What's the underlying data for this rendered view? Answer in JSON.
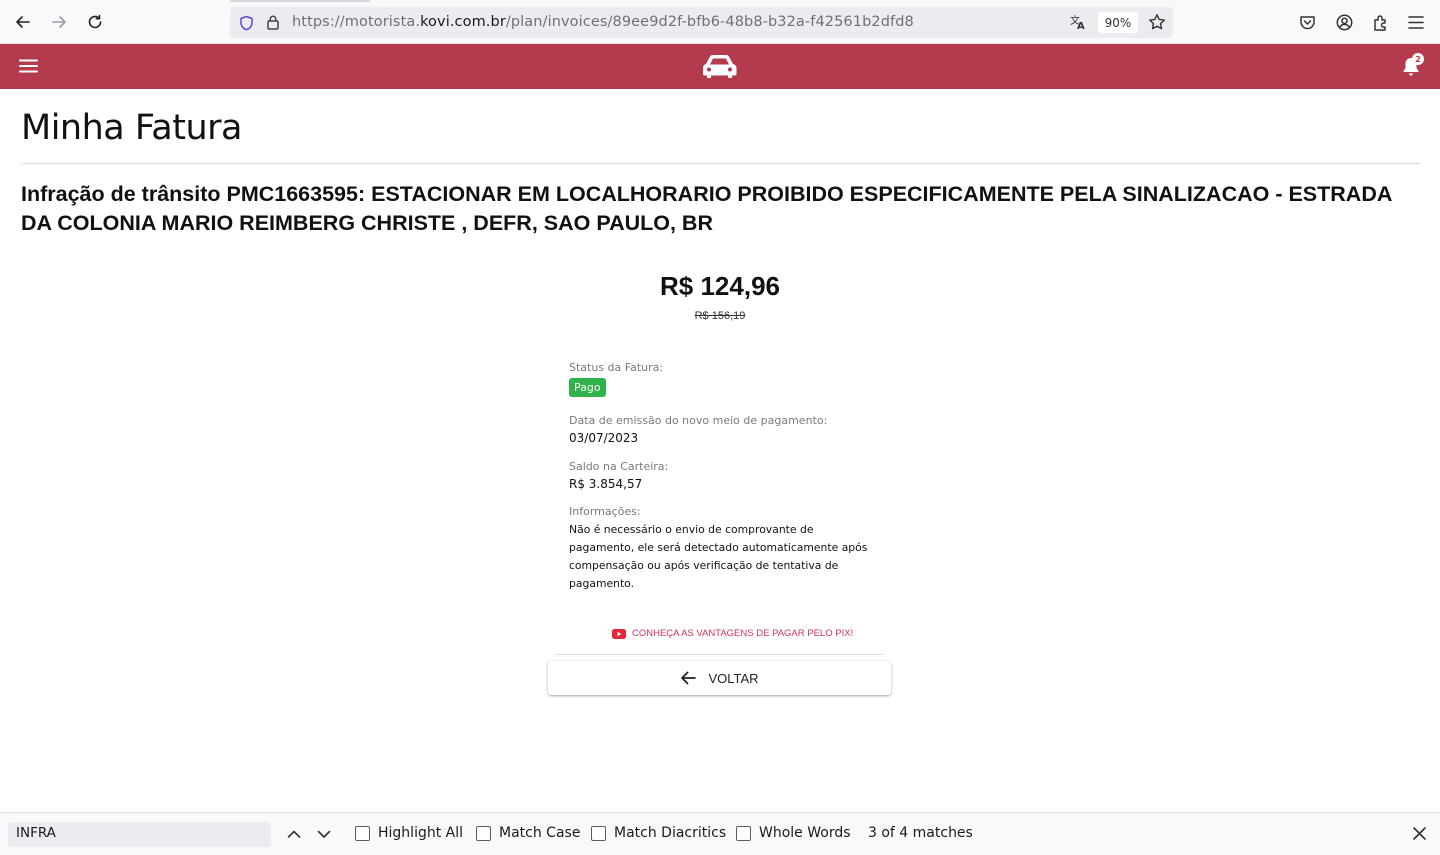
{
  "browser": {
    "url_prefix": "https://motorista.",
    "url_domain": "kovi.com.br",
    "url_path": "/plan/invoices/89ee9d2f-bfb6-48b8-b32a-f42561b2dfd8",
    "zoom": "90%"
  },
  "header": {
    "notification_count": "2",
    "brand_color": "#b43a4e"
  },
  "page": {
    "title": "Minha Fatura",
    "invoice_heading": "Infração de trânsito PMC1663595: ESTACIONAR EM LOCALHORARIO PROIBIDO ESPECIFICAMENTE PELA SINALIZACAO - ESTRADA DA COLONIA MARIO REIMBERG CHRISTE , DEFR, SAO PAULO, BR",
    "amount": "R$ 124,96",
    "old_amount": "R$ 156,19"
  },
  "details": {
    "status_label": "Status da Fatura:",
    "status_value": "Pago",
    "status_color": "#2fb24a",
    "issue_date_label": "Data de emissão do novo meio de pagamento:",
    "issue_date_value": "03/07/2023",
    "wallet_label": "Saldo na Carteira:",
    "wallet_value": "R$ 3.854,57",
    "info_label": "Informações:",
    "info_text": "Não é necessário o envio de comprovante de pagamento, ele será detectado automaticamente após compensação ou após verificação de tentativa de pagamento."
  },
  "actions": {
    "pix_link": "CONHEÇA AS VANTAGENS DE PAGAR PELO PIX!",
    "back_label": "VOLTAR"
  },
  "find_bar": {
    "query": "INFRA",
    "highlight_all": "Highlight All",
    "match_case": "Match Case",
    "match_diacritics": "Match Diacritics",
    "whole_words": "Whole Words",
    "match_count": "3 of 4 matches"
  }
}
